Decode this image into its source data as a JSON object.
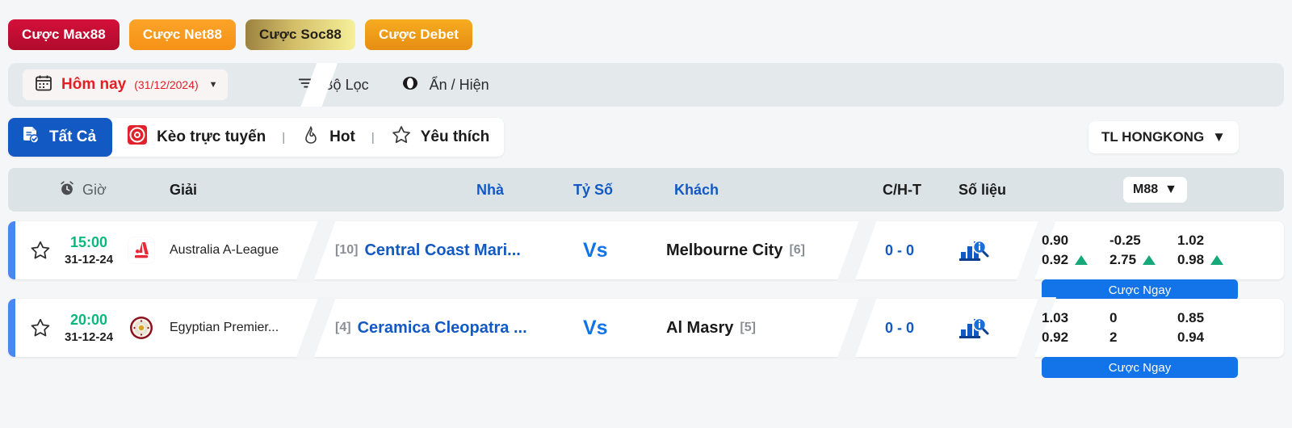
{
  "promos": [
    {
      "label": "Cược Max88",
      "style": "promo-max"
    },
    {
      "label": "Cược Net88",
      "style": "promo-net"
    },
    {
      "label": "Cược Soc88",
      "style": "promo-soc"
    },
    {
      "label": "Cược Debet",
      "style": "promo-deb"
    }
  ],
  "filter_bar": {
    "date_icon": "calendar-icon",
    "date_label": "Hôm nay",
    "date_value": "(31/12/2024)",
    "caret": "▼",
    "filter_icon": "filter-icon",
    "filter_label": "Bộ Lọc",
    "visibility_icon": "eye-icon",
    "visibility_label": "Ẩn / Hiện"
  },
  "tabs": [
    {
      "label": "Tất Cả",
      "icon": "document-check-icon",
      "active": true
    },
    {
      "label": "Kèo trực tuyến",
      "icon": "live-target-icon",
      "active": false
    },
    {
      "label": "Hot",
      "icon": "flame-icon",
      "active": false
    },
    {
      "label": "Yêu thích",
      "icon": "star-icon",
      "active": false
    }
  ],
  "tab_separator": "|",
  "region": {
    "label": "TL HONGKONG",
    "caret": "▼"
  },
  "table_header": {
    "time_icon": "alarm-clock-icon",
    "time": "Giờ",
    "league": "Giải",
    "home": "Nhà",
    "score": "Tỷ Số",
    "away": "Khách",
    "cht": "C/H-T",
    "stats": "Số liệu",
    "bookmaker": "M88",
    "bookmaker_caret": "▼"
  },
  "matches": [
    {
      "favorite_icon": "star-outline-icon",
      "kickoff": "15:00",
      "date": "31-12-24",
      "league_logo": "a-league-logo",
      "league": "Australia A-League",
      "home_rank": "[10]",
      "home_team": "Central Coast Mari...",
      "vs": "Vs",
      "away_team": "Melbourne City",
      "away_rank": "[6]",
      "score": "0 - 0",
      "stats_icon": "stats-search-icon",
      "odds": [
        {
          "top": "0.90",
          "bottom": "0.92",
          "top_arrow": false,
          "bottom_arrow": true
        },
        {
          "top": "-0.25",
          "bottom": "2.75",
          "top_arrow": false,
          "bottom_arrow": true
        },
        {
          "top": "1.02",
          "bottom": "0.98",
          "top_arrow": false,
          "bottom_arrow": true
        }
      ],
      "bet_now": "Cược Ngay"
    },
    {
      "favorite_icon": "star-outline-icon",
      "kickoff": "20:00",
      "date": "31-12-24",
      "league_logo": "egyptian-fa-logo",
      "league": "Egyptian Premier...",
      "home_rank": "[4]",
      "home_team": "Ceramica Cleopatra ...",
      "vs": "Vs",
      "away_team": "Al Masry",
      "away_rank": "[5]",
      "score": "0 - 0",
      "stats_icon": "stats-search-icon",
      "odds": [
        {
          "top": "1.03",
          "bottom": "0.92",
          "top_arrow": false,
          "bottom_arrow": false
        },
        {
          "top": "0",
          "bottom": "2",
          "top_arrow": false,
          "bottom_arrow": false
        },
        {
          "top": "0.85",
          "bottom": "0.94",
          "top_arrow": false,
          "bottom_arrow": false
        }
      ],
      "bet_now": "Cược Ngay"
    }
  ],
  "colors": {
    "accent_blue": "#1259c3",
    "brand_red": "#e31e24",
    "up_green": "#17a87a",
    "time_green": "#0ab87f",
    "bet_blue": "#1274e8"
  }
}
